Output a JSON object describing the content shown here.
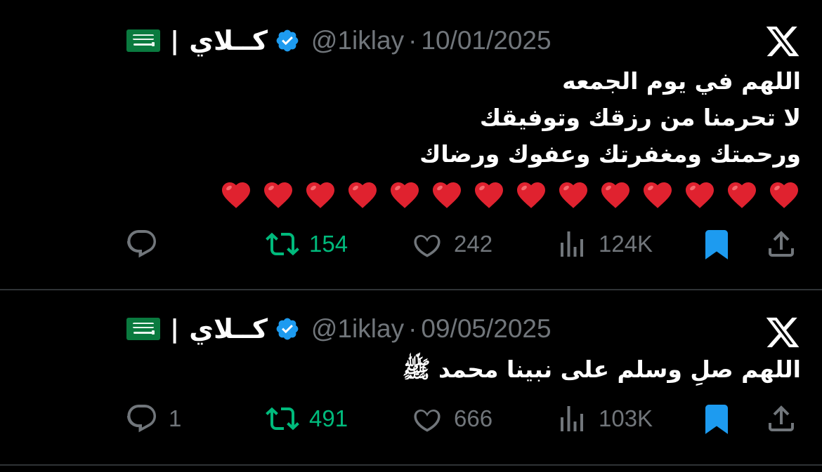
{
  "colors": {
    "background": "#000000",
    "text": "#ffffff",
    "muted": "#71767b",
    "retweet": "#00ba7c",
    "bookmark": "#1d9bf0",
    "divider": "#2f3336",
    "heart": "#e0222f"
  },
  "tweets": [
    {
      "author_name": "كــلاي",
      "separator": "|",
      "flag_icon": "saudi-flag-icon",
      "verified_icon": "verified-badge-icon",
      "handle": "@1iklay",
      "dot": "·",
      "date": "10/01/2025",
      "lines": [
        "اللهم في يوم الجمعه",
        "لا تحرمنا من رزقك وتوفيقك",
        "ورحمتك ومغفرتك وعفوك ورضاك"
      ],
      "heart_count": 14,
      "stats": {
        "replies": "",
        "retweets": "154",
        "likes": "242",
        "views": "124K"
      }
    },
    {
      "author_name": "كــلاي",
      "separator": "|",
      "flag_icon": "saudi-flag-icon",
      "verified_icon": "verified-badge-icon",
      "handle": "@1iklay",
      "dot": "·",
      "date": "09/05/2025",
      "lines": [
        "اللهم صلِ وسلم على نبينا محمد ﷺ"
      ],
      "heart_count": 0,
      "stats": {
        "replies": "1",
        "retweets": "491",
        "likes": "666",
        "views": "103K"
      }
    }
  ]
}
